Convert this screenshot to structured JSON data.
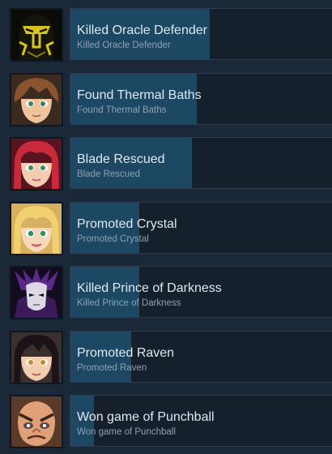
{
  "achievements": [
    {
      "title": "Killed Oracle Defender",
      "description": "Killed Oracle Defender",
      "progress": 0.53,
      "icon": "oracle-defender-icon"
    },
    {
      "title": "Found Thermal Baths",
      "description": "Found Thermal Baths",
      "progress": 0.48,
      "icon": "brown-haired-boy-icon"
    },
    {
      "title": "Blade Rescued",
      "description": "Blade Rescued",
      "progress": 0.46,
      "icon": "red-haired-girl-icon"
    },
    {
      "title": "Promoted Crystal",
      "description": "Promoted Crystal",
      "progress": 0.26,
      "icon": "blonde-girl-icon"
    },
    {
      "title": "Killed Prince of Darkness",
      "description": "Killed Prince of Darkness",
      "progress": 0.26,
      "icon": "prince-of-darkness-icon"
    },
    {
      "title": "Promoted Raven",
      "description": "Promoted Raven",
      "progress": 0.23,
      "icon": "dark-haired-girl-icon"
    },
    {
      "title": "Won game of Punchball",
      "description": "Won game of Punchball",
      "progress": 0.09,
      "icon": "punchball-fighter-icon"
    }
  ],
  "colors": {
    "background": "#1b2838",
    "bar_fill": "#1c4864",
    "bar_track": "#16202d",
    "title_text": "#e1e8ef",
    "desc_text": "#8fa0b2"
  }
}
